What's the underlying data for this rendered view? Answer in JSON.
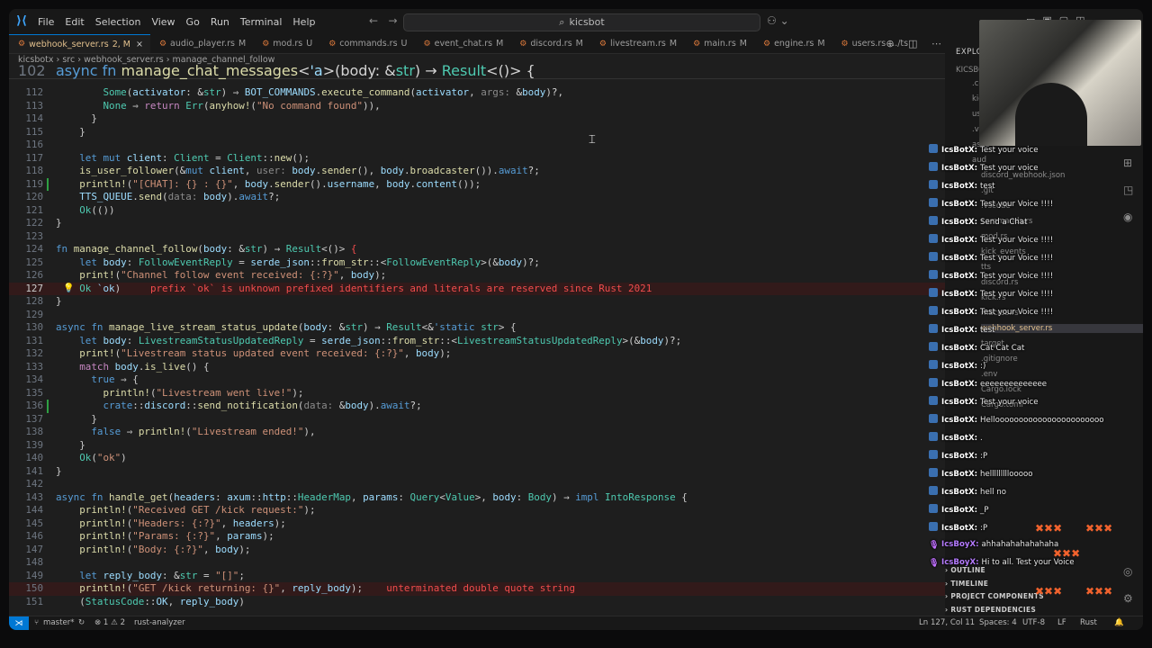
{
  "titlebar": {
    "menu": [
      "File",
      "Edit",
      "Selection",
      "View",
      "Go",
      "Run",
      "Terminal",
      "Help"
    ],
    "search_text": "kicsbot"
  },
  "tabs": [
    {
      "name": "webhook_server.rs",
      "status": "2, M",
      "active": true
    },
    {
      "name": "audio_player.rs",
      "status": "M"
    },
    {
      "name": "mod.rs",
      "status": "U"
    },
    {
      "name": "commands.rs",
      "status": "U"
    },
    {
      "name": "event_chat.rs",
      "status": "M"
    },
    {
      "name": "discord.rs",
      "status": "M"
    },
    {
      "name": "livestream.rs",
      "status": "M"
    },
    {
      "name": "main.rs",
      "status": "M"
    },
    {
      "name": "engine.rs",
      "status": "M"
    },
    {
      "name": "users.rs",
      "status": ".../ts"
    }
  ],
  "breadcrumb": [
    "kicsbotx",
    "src",
    "webhook_server.rs",
    "manage_channel_follow"
  ],
  "sticky": {
    "num": "102",
    "html": "<span class='k'>async fn</span> <span class='f'>manage_chat_messages</span><span class='o'>&lt;</span><span class='v'>'a</span><span class='o'>&gt;(body: &amp;</span><span class='t'>str</span><span class='o'>) → </span><span class='t'>Result</span><span class='o'>&lt;()&gt; {</span>"
  },
  "editor_lines": [
    {
      "num": "112",
      "g": "",
      "html": "        <span class='t'>Some</span>(<span class='v'>activator</span>: <span class='o'>&amp;</span><span class='t'>str</span>) ⇒ <span class='v'>BOT_COMMANDS</span>.<span class='f'>execute_command</span>(<span class='v'>activator</span>, <span class='h'>args:</span> <span class='o'>&amp;</span><span class='v'>body</span>)<span class='o'>?</span>,"
    },
    {
      "num": "113",
      "g": "",
      "html": "        <span class='t'>None</span> ⇒ <span class='c'>return</span> <span class='t'>Err</span>(<span class='f'>anyhow!</span>(<span class='s'>\"No command found\"</span>)),"
    },
    {
      "num": "114",
      "g": "",
      "html": "      }"
    },
    {
      "num": "115",
      "g": "",
      "html": "    }"
    },
    {
      "num": "116",
      "g": "",
      "html": ""
    },
    {
      "num": "117",
      "g": "",
      "html": "    <span class='k'>let mut</span> <span class='v'>client</span>: <span class='t'>Client</span> = <span class='t'>Client</span>::<span class='f'>new</span>();"
    },
    {
      "num": "118",
      "g": "",
      "html": "    <span class='f'>is_user_follower</span>(<span class='o'>&amp;</span><span class='k'>mut</span> <span class='v'>client</span>, <span class='h'>user:</span> <span class='v'>body</span>.<span class='f'>sender</span>(), <span class='v'>body</span>.<span class='f'>broadcaster</span>()).<span class='k'>await</span><span class='o'>?</span>;"
    },
    {
      "num": "119",
      "g": "add",
      "html": "    <span class='f'>println!</span>(<span class='s'>\"[CHAT]: {} : {}\"</span>, <span class='v'>body</span>.<span class='f'>sender</span>().<span class='v'>username</span>, <span class='v'>body</span>.<span class='v'>content</span>());"
    },
    {
      "num": "120",
      "g": "",
      "html": "    <span class='v'>TTS_QUEUE</span>.<span class='f'>send</span>(<span class='h'>data:</span> <span class='v'>body</span>).<span class='k'>await</span><span class='o'>?</span>;"
    },
    {
      "num": "121",
      "g": "",
      "html": "    <span class='t'>Ok</span>(())"
    },
    {
      "num": "122",
      "g": "",
      "html": "}"
    },
    {
      "num": "123",
      "g": "",
      "html": ""
    },
    {
      "num": "124",
      "g": "",
      "html": "<span class='k'>fn</span> <span class='f'>manage_channel_follow</span>(<span class='v'>body</span>: <span class='o'>&amp;</span><span class='t'>str</span>) → <span class='t'>Result</span>&lt;()&gt; <span class='r'>{</span>"
    },
    {
      "num": "125",
      "g": "",
      "html": "    <span class='k'>let</span> <span class='v'>body</span>: <span class='t'>FollowEventReply</span> = <span class='v'>serde_json</span>::<span class='f'>from_str</span>::&lt;<span class='t'>FollowEventReply</span>&gt;(<span class='o'>&amp;</span><span class='v'>body</span>)<span class='o'>?</span>;"
    },
    {
      "num": "126",
      "g": "",
      "html": "    <span class='f'>print!</span>(<span class='s'>\"Channel follow event received: {:?}\"</span>, <span class='v'>body</span>);"
    },
    {
      "num": "127",
      "g": "",
      "cur": true,
      "err": true,
      "html": "    <span class='t'>Ok</span> <span class='v'>`ok</span>)     <span class='e'>prefix `ok` is unknown prefixed identifiers and literals are reserved since Rust 2021</span>"
    },
    {
      "num": "128",
      "g": "",
      "html": "}"
    },
    {
      "num": "129",
      "g": "",
      "html": ""
    },
    {
      "num": "130",
      "g": "",
      "html": "<span class='k'>async fn</span> <span class='f'>manage_live_stream_status_update</span>(<span class='v'>body</span>: <span class='o'>&amp;</span><span class='t'>str</span>) → <span class='t'>Result</span>&lt;<span class='o'>&amp;</span><span class='k'>'static</span> <span class='t'>str</span>&gt; {"
    },
    {
      "num": "131",
      "g": "",
      "html": "    <span class='k'>let</span> <span class='v'>body</span>: <span class='t'>LivestreamStatusUpdatedReply</span> = <span class='v'>serde_json</span>::<span class='f'>from_str</span>::&lt;<span class='t'>LivestreamStatusUpdatedReply</span>&gt;(<span class='o'>&amp;</span><span class='v'>body</span>)<span class='o'>?</span>;"
    },
    {
      "num": "132",
      "g": "",
      "html": "    <span class='f'>print!</span>(<span class='s'>\"Livestream status updated event received: {:?}\"</span>, <span class='v'>body</span>);"
    },
    {
      "num": "133",
      "g": "",
      "html": "    <span class='c'>match</span> <span class='v'>body</span>.<span class='f'>is_live</span>() {"
    },
    {
      "num": "134",
      "g": "",
      "html": "      <span class='k'>true</span> ⇒ {"
    },
    {
      "num": "135",
      "g": "",
      "html": "        <span class='f'>println!</span>(<span class='s'>\"Livestream went live!\"</span>);"
    },
    {
      "num": "136",
      "g": "add",
      "html": "        <span class='k'>crate</span>::<span class='v'>discord</span>::<span class='f'>send_notification</span>(<span class='h'>data:</span> <span class='o'>&amp;</span><span class='v'>body</span>).<span class='k'>await</span><span class='o'>?</span>;"
    },
    {
      "num": "137",
      "g": "",
      "html": "      }"
    },
    {
      "num": "138",
      "g": "",
      "html": "      <span class='k'>false</span> ⇒ <span class='f'>println!</span>(<span class='s'>\"Livestream ended!\"</span>),"
    },
    {
      "num": "139",
      "g": "",
      "html": "    }"
    },
    {
      "num": "140",
      "g": "",
      "html": "    <span class='t'>Ok</span>(<span class='s'>\"ok\"</span>)"
    },
    {
      "num": "141",
      "g": "",
      "html": "}"
    },
    {
      "num": "142",
      "g": "",
      "html": ""
    },
    {
      "num": "143",
      "g": "",
      "html": "<span class='k'>async fn</span> <span class='f'>handle_get</span>(<span class='v'>headers</span>: <span class='v'>axum</span>::<span class='v'>http</span>::<span class='t'>HeaderMap</span>, <span class='v'>params</span>: <span class='t'>Query</span>&lt;<span class='t'>Value</span>&gt;, <span class='v'>body</span>: <span class='t'>Body</span>) → <span class='k'>impl</span> <span class='t'>IntoResponse</span> {"
    },
    {
      "num": "144",
      "g": "",
      "html": "    <span class='f'>println!</span>(<span class='s'>\"Received GET /kick request:\"</span>);"
    },
    {
      "num": "145",
      "g": "",
      "html": "    <span class='f'>println!</span>(<span class='s'>\"Headers: {:?}\"</span>, <span class='v'>headers</span>);"
    },
    {
      "num": "146",
      "g": "",
      "html": "    <span class='f'>println!</span>(<span class='s'>\"Params: {:?}\"</span>, <span class='v'>params</span>);"
    },
    {
      "num": "147",
      "g": "",
      "html": "    <span class='f'>println!</span>(<span class='s'>\"Body: {:?}\"</span>, <span class='v'>body</span>);"
    },
    {
      "num": "148",
      "g": "",
      "html": ""
    },
    {
      "num": "149",
      "g": "",
      "html": "    <span class='k'>let</span> <span class='v'>reply_body</span>: <span class='o'>&amp;</span><span class='t'>str</span> = <span class='s'>\"[]\"</span>;"
    },
    {
      "num": "150",
      "g": "",
      "err": true,
      "html": "    <span class='f'>println!</span>(<span class='s'>\"GET /kick returning: {}\"</span>, <span class='v'>reply_body</span>);    <span class='e'>unterminated double quote string</span>"
    },
    {
      "num": "151",
      "g": "",
      "html": "    (<span class='t'>StatusCode</span>::<span class='v'>OK</span>, <span class='v'>reply_body</span>)"
    }
  ],
  "explorer": {
    "title": "EXPLORER",
    "root": "KICSBOT",
    "items": [
      ".cont",
      "kick",
      "use",
      ".vsc",
      "asse",
      "aud",
      "discord_webhook.json",
      ".git",
      ".vscode",
      "commands.rs",
      "mod.rs",
      "kick_events",
      "tts",
      "discord.rs",
      "kick.rs",
      "macros.rs",
      "webhook_server.rs",
      "target",
      ".gitignore",
      ".env",
      "Cargo.lock",
      "Cargo.toml"
    ],
    "sel_status": "2, M",
    "sections": [
      "OUTLINE",
      "TIMELINE",
      "PROJECT COMPONENTS",
      "RUST DEPENDENCIES"
    ]
  },
  "chat": [
    {
      "user": "IcsBotX:",
      "text": "Test your voice"
    },
    {
      "user": "IcsBotX:",
      "text": "Test your voice"
    },
    {
      "user": "IcsBotX:",
      "text": "test"
    },
    {
      "user": "IcsBotX:",
      "text": "Test your Voice !!!!"
    },
    {
      "user": "IcsBotX:",
      "text": "Send a Chat"
    },
    {
      "user": "IcsBotX:",
      "text": "Test your Voice !!!!"
    },
    {
      "user": "IcsBotX:",
      "text": "Test your Voice !!!!"
    },
    {
      "user": "IcsBotX:",
      "text": "Test your Voice !!!!"
    },
    {
      "user": "IcsBotX:",
      "text": "Test your Voice !!!!"
    },
    {
      "user": "IcsBotX:",
      "text": "Test your Voice !!!!"
    },
    {
      "user": "IcsBotX:",
      "text": "test"
    },
    {
      "user": "IcsBotX:",
      "text": "Cat Cat Cat"
    },
    {
      "user": "IcsBotX:",
      "text": ":)"
    },
    {
      "user": "IcsBotX:",
      "text": "eeeeeeeeeeeeee"
    },
    {
      "user": "IcsBotX:",
      "text": "Test your voice"
    },
    {
      "user": "IcsBotX:",
      "text": "Hellooooooooooooooooooooooo"
    },
    {
      "user": "IcsBotX:",
      "text": "."
    },
    {
      "user": "IcsBotX:",
      "text": ":P"
    },
    {
      "user": "IcsBotX:",
      "text": "helllllllllooooo"
    },
    {
      "user": "IcsBotX:",
      "text": "hell no"
    },
    {
      "user": "IcsBotX:",
      "text": "_P"
    },
    {
      "user": "IcsBotX:",
      "text": ":P"
    },
    {
      "user": "IcsBoyX:",
      "text": "ahhahahahahahaha",
      "mic": true
    },
    {
      "user": "IcsBoyX:",
      "text": "Hi to all. Test your Voice",
      "mic": true
    }
  ],
  "status": {
    "branch": "master*",
    "problems": "⊗ 1 ⚠ 2",
    "lsp": "rust-analyzer",
    "position": "Ln 127, Col 11",
    "spaces": "Spaces: 4",
    "encoding": "UTF-8",
    "eol": "LF",
    "language": "Rust"
  }
}
